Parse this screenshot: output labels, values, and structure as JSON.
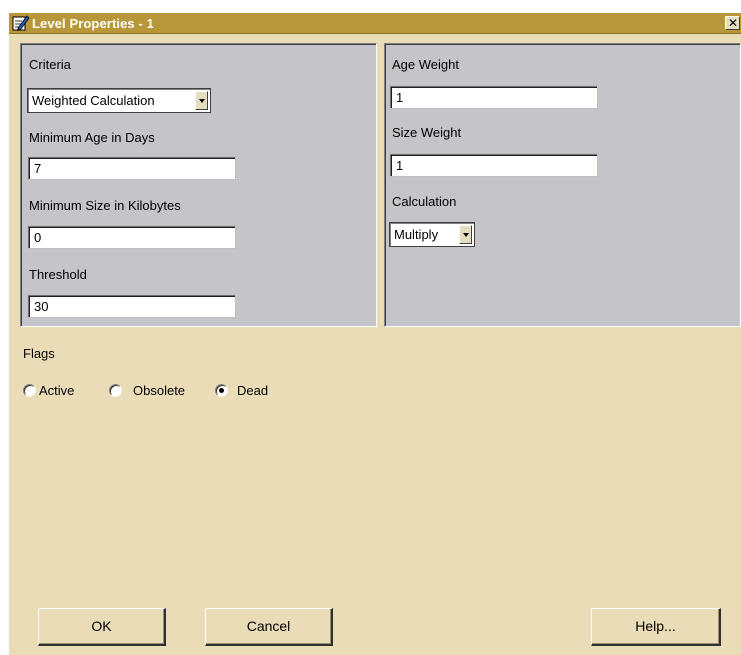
{
  "window": {
    "title": "Level Properties - 1",
    "icon": "pencil-notepad-icon",
    "close_icon": "close-icon",
    "close_glyph": "✕"
  },
  "left_panel": {
    "criteria_label": "Criteria",
    "criteria_value": "Weighted Calculation",
    "min_age_label": "Minimum Age in Days",
    "min_age_value": "7",
    "min_size_label": "Minimum Size in Kilobytes",
    "min_size_value": "0",
    "threshold_label": "Threshold",
    "threshold_value": "30"
  },
  "right_panel": {
    "age_weight_label": "Age Weight",
    "age_weight_value": "1",
    "size_weight_label": "Size Weight",
    "size_weight_value": "1",
    "calculation_label": "Calculation",
    "calculation_value": "Multiply"
  },
  "flags": {
    "label": "Flags",
    "options": [
      {
        "label": "Active",
        "checked": false
      },
      {
        "label": "Obsolete",
        "checked": false
      },
      {
        "label": "Dead",
        "checked": true
      }
    ]
  },
  "buttons": {
    "ok": "OK",
    "cancel": "Cancel",
    "help": "Help..."
  },
  "colors": {
    "titlebar": "#b7973a",
    "dialog_bg": "#e9dcb6",
    "panel_bg": "#c5c4c9"
  }
}
